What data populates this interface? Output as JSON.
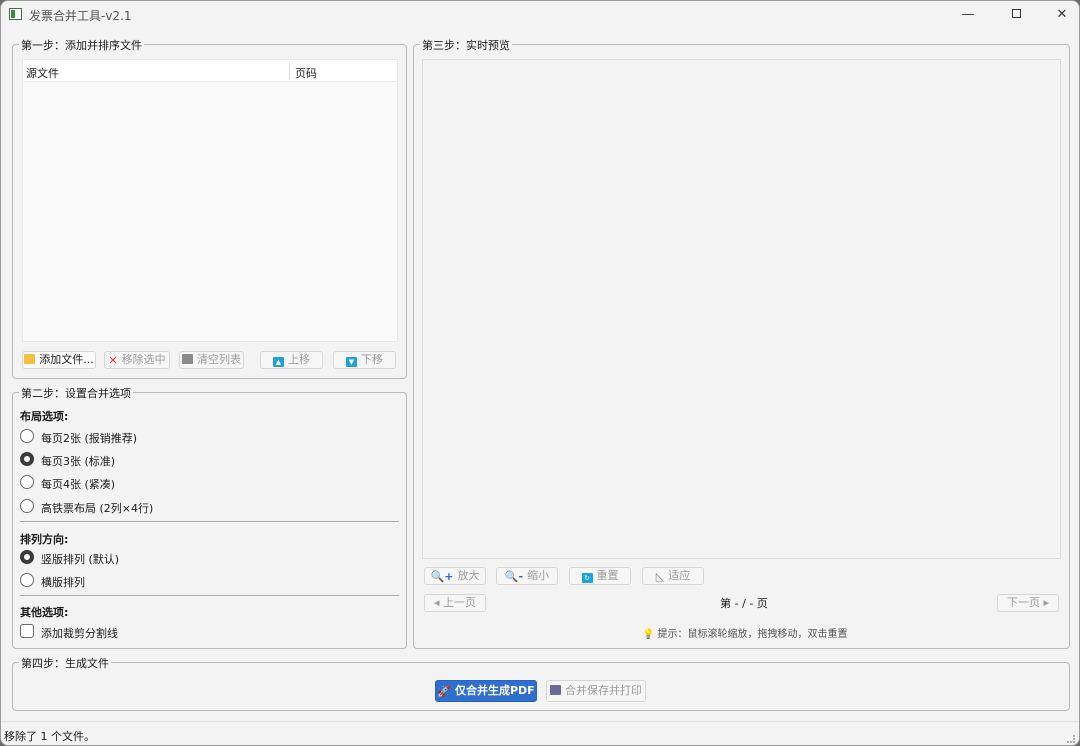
{
  "window": {
    "title": "发票合并工具-v2.1",
    "min_glyph": "—",
    "close_glyph": "✕"
  },
  "step1": {
    "legend": "第一步：添加并排序文件",
    "columns": [
      "源文件",
      "页码"
    ],
    "buttons": {
      "add": "添加文件...",
      "remove": "移除选中",
      "clear": "清空列表",
      "up": "上移",
      "down": "下移"
    }
  },
  "step2": {
    "legend": "第二步：设置合并选项",
    "layout_title": "布局选项:",
    "layout_options": [
      "每页2张 (报销推荐)",
      "每页3张 (标准)",
      "每页4张 (紧凑)",
      "高铁票布局 (2列×4行)"
    ],
    "layout_selected": 1,
    "direction_title": "排列方向:",
    "direction_options": [
      "竖版排列 (默认)",
      "横版排列"
    ],
    "direction_selected": 0,
    "other_title": "其他选项:",
    "cut_line_label": "添加裁剪分割线",
    "cut_line_checked": false
  },
  "step3": {
    "legend": "第三步：实时预览",
    "zoom_in": "放大",
    "zoom_out": "缩小",
    "reset": "重置",
    "fit": "适应",
    "prev": "◂ 上一页",
    "next": "下一页 ▸",
    "page_indicator": "第 - / - 页",
    "hint": "提示：鼠标滚轮缩放，拖拽移动，双击重置"
  },
  "step4": {
    "legend": "第四步：生成文件",
    "generate": "仅合并生成PDF",
    "save_print": "合并保存并打印"
  },
  "status": {
    "text": "移除了 1 个文件。"
  },
  "icons": {
    "zoom_in": "🔍+",
    "zoom_out": "🔍-",
    "up": "▲",
    "down": "▼",
    "reset": "↻",
    "fit": "◺",
    "rocket": "🚀",
    "bulb": "💡"
  },
  "colors": {
    "primary": "#2e6fcf",
    "icon_blue": "#1ea2d8",
    "remove_red": "#d9304a",
    "folder_yellow": "#f5c040"
  }
}
